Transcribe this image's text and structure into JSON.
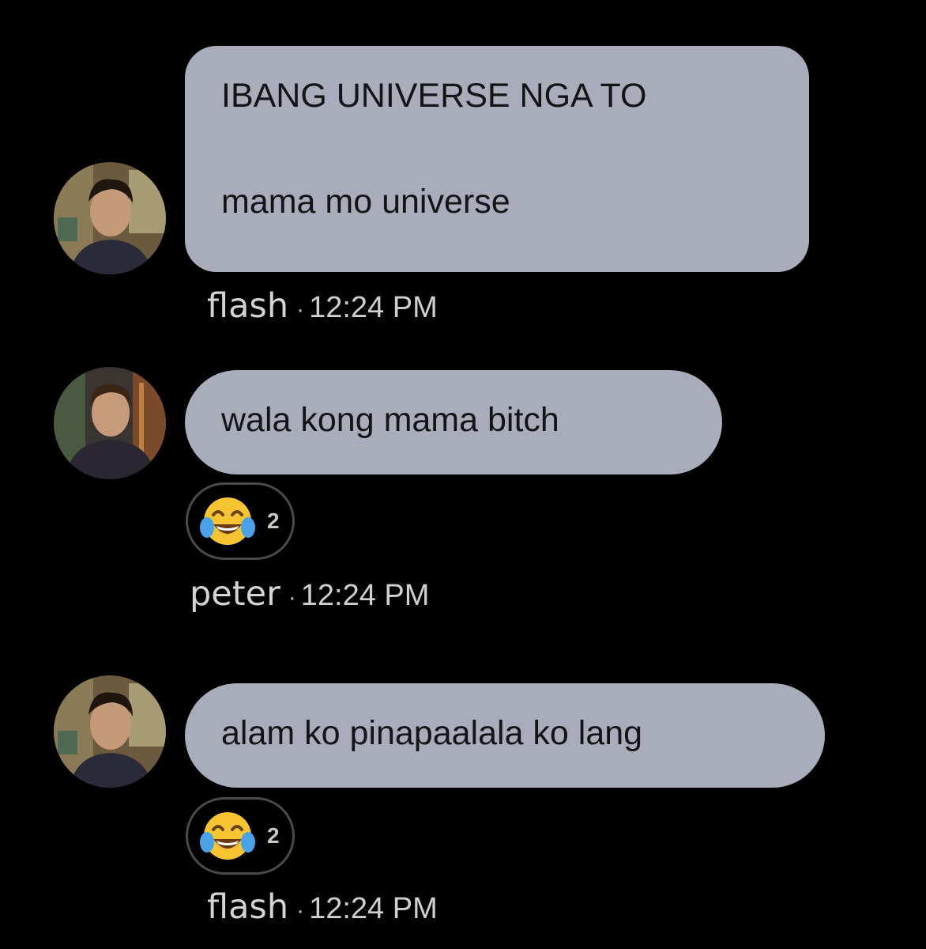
{
  "messages": [
    {
      "sender": "flash",
      "separator": "·",
      "time": "12:24 PM",
      "lines": [
        "IBANG UNIVERSE NGA TO",
        "mama mo universe"
      ],
      "avatar": "flash-avatar"
    },
    {
      "sender": "peter",
      "separator": "·",
      "time": "12:24 PM",
      "lines": [
        "wala kong mama bitch"
      ],
      "avatar": "peter-avatar",
      "reaction": {
        "icon": "face-with-tears-of-joy-icon",
        "count": "2"
      }
    },
    {
      "sender": "flash",
      "separator": "·",
      "time": "12:24 PM",
      "lines": [
        "alam ko pinapaalala ko lang"
      ],
      "avatar": "flash-avatar",
      "reaction": {
        "icon": "face-with-tears-of-joy-icon",
        "count": "2"
      }
    }
  ],
  "colors": {
    "background": "#000000",
    "bubble": "#a9adbb",
    "bubble_text": "#141416",
    "meta_text": "#d0d0d3"
  }
}
